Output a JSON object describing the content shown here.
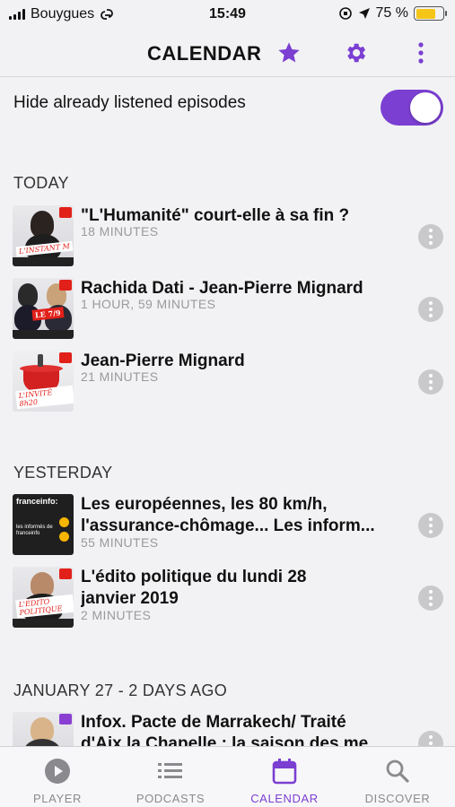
{
  "status_bar": {
    "carrier": "Bouygues",
    "time": "15:49",
    "battery_percent": "75 %",
    "battery_level": 0.75
  },
  "header": {
    "title": "CALENDAR",
    "icons": [
      "star-icon",
      "gear-icon",
      "more-vertical-icon"
    ]
  },
  "filter": {
    "label": "Hide already listened episodes",
    "enabled": true
  },
  "sections": [
    {
      "title": "TODAY",
      "episodes": [
        {
          "title": "\"L'Humanité\" court-elle à sa fin ?",
          "duration": "18 MINUTES"
        },
        {
          "title": "Rachida Dati - Jean-Pierre Mignard",
          "duration": "1 HOUR, 59 MINUTES"
        },
        {
          "title": "Jean-Pierre Mignard",
          "duration": "21 MINUTES"
        }
      ]
    },
    {
      "title": "YESTERDAY",
      "episodes": [
        {
          "title_line1": "Les européennes, les 80 km/h,",
          "title_line2": "l'assurance-chômage... Les inform...",
          "duration": "55 MINUTES"
        },
        {
          "title_line1": "L'édito politique du lundi 28",
          "title_line2": "janvier 2019",
          "duration": "2 MINUTES"
        }
      ]
    },
    {
      "title": "JANUARY 27 - 2 DAYS AGO",
      "episodes": [
        {
          "title_line1": "Infox. Pacte de Marrakech/ Traité",
          "title_line2": "d'Aix la Chapelle : la saison des me..."
        }
      ]
    }
  ],
  "thumb_labels": {
    "t1": "L'INSTANT M",
    "t2": "LE 7/9",
    "t3": "L'INVITÉ 8h20",
    "t4_brand": "franceinfo:",
    "t4_text": "les informés de franceinfo",
    "t5": "L'ÉDITO POLITIQUE"
  },
  "tab_bar": {
    "tabs": [
      {
        "label": "PLAYER",
        "icon": "play-icon"
      },
      {
        "label": "PODCASTS",
        "icon": "list-icon"
      },
      {
        "label": "CALENDAR",
        "icon": "calendar-icon",
        "active": true
      },
      {
        "label": "DISCOVER",
        "icon": "search-icon"
      }
    ]
  },
  "colors": {
    "accent": "#7b3fd2",
    "background": "#f2f2f4",
    "battery": "#f5c518"
  }
}
